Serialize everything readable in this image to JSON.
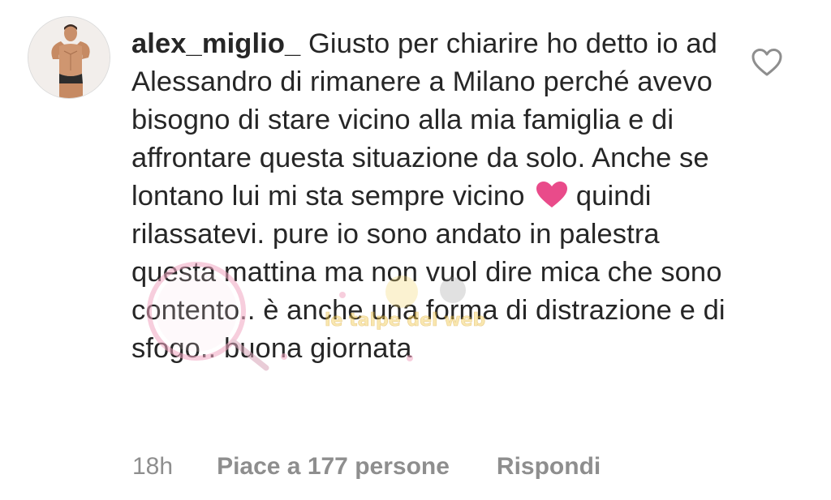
{
  "comment": {
    "username": "alex_miglio_",
    "text": "Giusto per chiarire ho detto io ad Alessandro di rimanere a Milano perché avevo bisogno di stare vicino alla mia famiglia e di affrontare questa situazione da solo. Anche se lontano lui mi sta sempre vicino",
    "text_after_emoji": "quindi rilassatevi. pure io sono andato in palestra questa mattina ma non vuol dire mica che sono contento.. è anche una forma di distrazione e di sfogo.. buona giornata",
    "emoji": "heart-emoji",
    "time": "18h",
    "likes_label": "Piace a 177 persone",
    "reply_label": "Rispondi"
  },
  "watermark": {
    "text": "le talpe del web"
  },
  "colors": {
    "text": "#262626",
    "meta": "#8e8e8e",
    "heart_emoji": "#e94b8a",
    "watermark_pink": "#f2a7c3"
  },
  "icons": {
    "like": "heart-outline-icon",
    "avatar": "avatar"
  }
}
